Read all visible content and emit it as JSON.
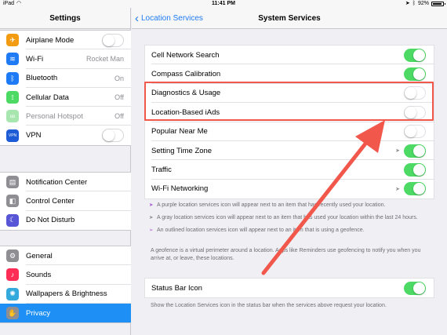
{
  "statusbar": {
    "device": "iPad",
    "time": "11:41 PM",
    "battery": "92%",
    "battery_level": 0.92
  },
  "sidebar": {
    "title": "Settings",
    "groups": [
      [
        {
          "label": "Airplane Mode",
          "icon": "airplane-icon",
          "color": "#f39c12",
          "glyph": "✈",
          "toggle": "off"
        },
        {
          "label": "Wi-Fi",
          "value": "Rocket Man",
          "icon": "wifi-icon",
          "color": "#1e7bf5",
          "glyph": "≋"
        },
        {
          "label": "Bluetooth",
          "value": "On",
          "icon": "bluetooth-icon",
          "color": "#1e7bf5",
          "glyph": "ᛒ"
        },
        {
          "label": "Cellular Data",
          "value": "Off",
          "icon": "cellular-icon",
          "color": "#4cd964",
          "glyph": "⟟"
        },
        {
          "label": "Personal Hotspot",
          "value": "Off",
          "icon": "hotspot-icon",
          "color": "#a8e6b0",
          "glyph": "∞",
          "dim": true
        },
        {
          "label": "VPN",
          "icon": "vpn-icon",
          "color": "#1e5bd7",
          "glyph": "VPN",
          "toggle": "off"
        }
      ],
      [
        {
          "label": "Notification Center",
          "icon": "notification-center-icon",
          "color": "#8e8e93",
          "glyph": "▤"
        },
        {
          "label": "Control Center",
          "icon": "control-center-icon",
          "color": "#8e8e93",
          "glyph": "◧"
        },
        {
          "label": "Do Not Disturb",
          "icon": "moon-icon",
          "color": "#5856d6",
          "glyph": "☾"
        }
      ],
      [
        {
          "label": "General",
          "icon": "gear-icon",
          "color": "#8e8e93",
          "glyph": "⚙"
        },
        {
          "label": "Sounds",
          "icon": "sounds-icon",
          "color": "#ff2d55",
          "glyph": "♪"
        },
        {
          "label": "Wallpapers & Brightness",
          "icon": "wallpaper-icon",
          "color": "#34aadc",
          "glyph": "✺"
        },
        {
          "label": "Privacy",
          "icon": "hand-icon",
          "color": "#8e8e93",
          "glyph": "✋",
          "selected": true
        }
      ]
    ]
  },
  "main": {
    "back_label": "Location Services",
    "title": "System Services",
    "rows": [
      {
        "label": "Cell Network Search",
        "toggle": "on"
      },
      {
        "label": "Compass Calibration",
        "toggle": "on"
      },
      {
        "label": "Diagnostics & Usage",
        "toggle": "off"
      },
      {
        "label": "Location-Based iAds",
        "toggle": "off"
      },
      {
        "label": "Popular Near Me",
        "toggle": "off"
      },
      {
        "label": "Setting Time Zone",
        "toggle": "on",
        "arrow": true
      },
      {
        "label": "Traffic",
        "toggle": "on"
      },
      {
        "label": "Wi-Fi Networking",
        "toggle": "on",
        "arrow": true
      }
    ],
    "legend": [
      {
        "kind": "purple",
        "text": "A purple location services icon will appear next to an item that has recently used your location."
      },
      {
        "kind": "gray",
        "text": "A gray location services icon will appear next to an item that has used your location within the last 24 hours."
      },
      {
        "kind": "outline",
        "text": "An outlined location services icon will appear next to an item that is using a geofence."
      }
    ],
    "geofence_note": "A geofence is a virtual perimeter around a location. Apps like Reminders use geofencing to notify you when you arrive at, or leave, these locations.",
    "status_bar_row": {
      "label": "Status Bar Icon",
      "toggle": "on"
    },
    "status_bar_note": "Show the Location Services icon in the status bar when the services above request your location."
  },
  "colors": {
    "accent": "#1e7bf5",
    "toggle_on": "#4cd964",
    "annotation": "#f2574b"
  }
}
